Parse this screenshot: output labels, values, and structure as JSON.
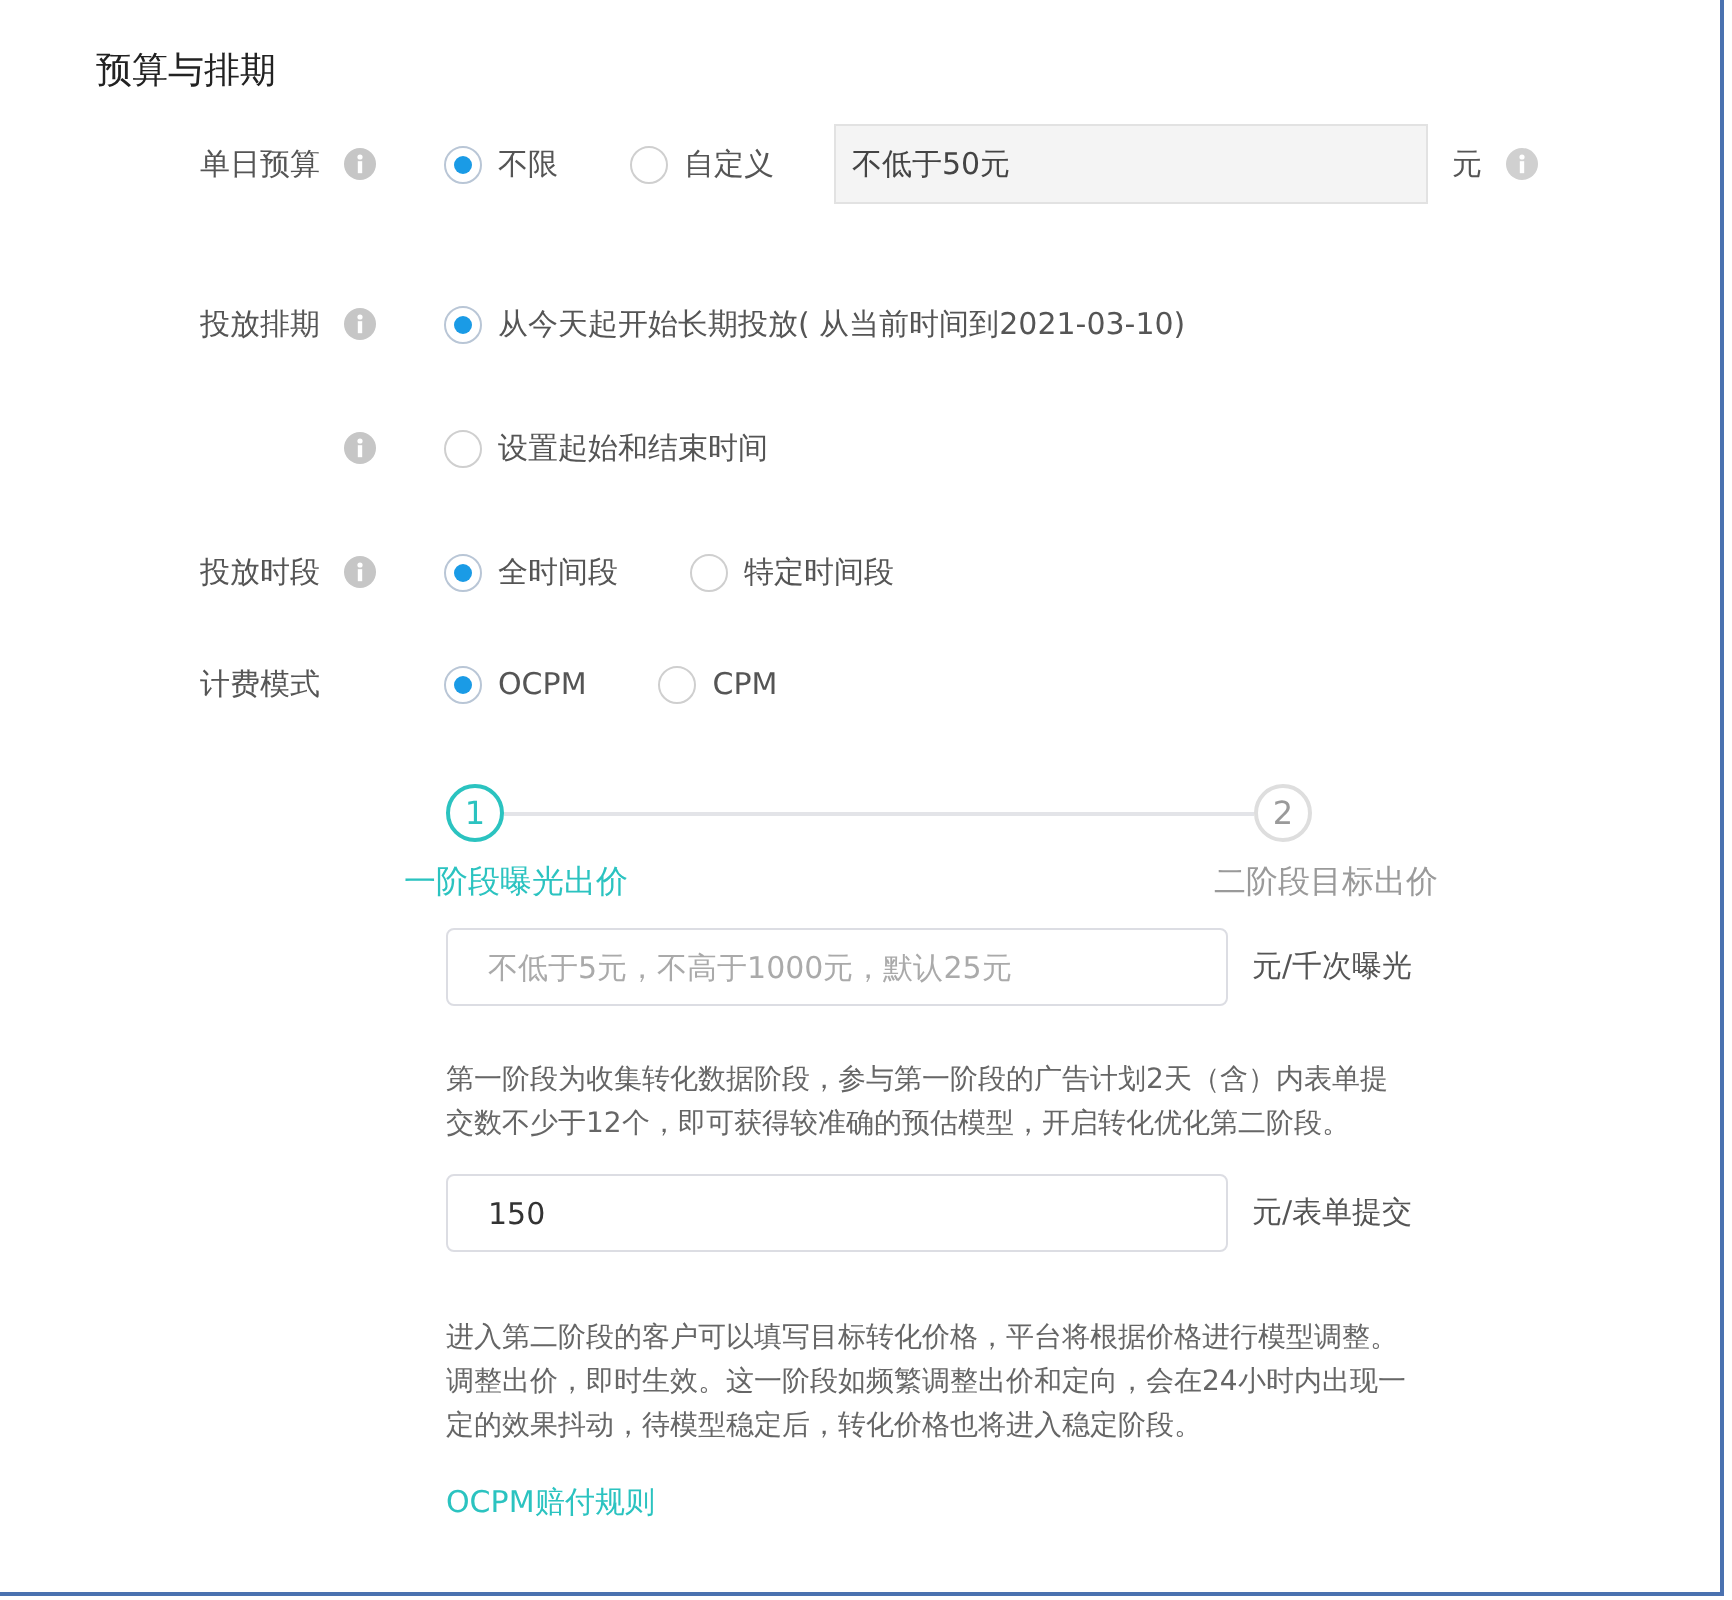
{
  "section_title": "预算与排期",
  "form_rows": [
    {
      "kind": "choice",
      "label": "单日预算",
      "info": true,
      "options": [
        {
          "label": "不限",
          "selected": true
        },
        {
          "label": "自定义",
          "selected": false
        }
      ],
      "input": {
        "value": "不低于50元"
      },
      "unit": "元",
      "unit_info": true
    },
    {
      "kind": "choice",
      "label": "投放排期",
      "info": true,
      "options": [
        {
          "label": "从今天起开始长期投放( 从当前时间到2021-03-10)",
          "selected": true
        }
      ]
    },
    {
      "kind": "choice",
      "info": true,
      "options": [
        {
          "label": "设置起始和结束时间",
          "selected": false
        }
      ]
    },
    {
      "kind": "choice",
      "label": "投放时段",
      "info": true,
      "options": [
        {
          "label": "全时间段",
          "selected": true
        },
        {
          "label": "特定时间段",
          "selected": false
        }
      ]
    },
    {
      "kind": "choice",
      "label": "计费模式",
      "info": false,
      "options": [
        {
          "label": "OCPM",
          "selected": true
        },
        {
          "label": "CPM",
          "selected": false
        }
      ]
    }
  ],
  "steps": [
    {
      "number": "1",
      "label": "一阶段曝光出价",
      "active": true
    },
    {
      "number": "2",
      "label": "二阶段目标出价",
      "active": false
    }
  ],
  "bid_blocks": [
    {
      "kind": "field",
      "placeholder": "不低于5元，不高于1000元，默认25元",
      "unit": "元/千次曝光"
    },
    {
      "kind": "note",
      "text": "第一阶段为收集转化数据阶段，参与第一阶段的广告计划2天（含）内表单提交数不少于12个，即可获得较准确的预估模型，开启转化优化第二阶段。"
    },
    {
      "kind": "field",
      "value": "150",
      "unit": "元/表单提交"
    },
    {
      "kind": "note",
      "text": "进入第二阶段的客户可以填写目标转化价格，平台将根据价格进行模型调整。调整出价，即时生效。这一阶段如频繁调整出价和定向，会在24小时内出现一定的效果抖动，待模型稳定后，转化价格也将进入稳定阶段。"
    },
    {
      "kind": "link",
      "text": "OCPM赔付规则"
    }
  ]
}
